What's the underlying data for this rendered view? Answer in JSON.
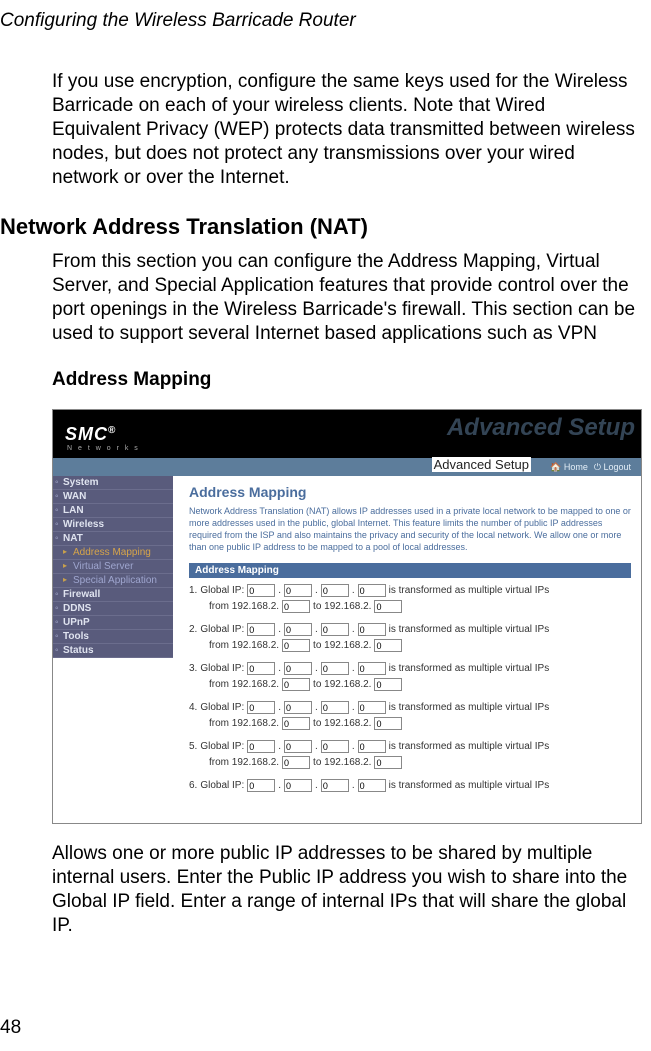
{
  "page": {
    "header_title": "Configuring the Wireless Barricade Router",
    "para1": "If you use encryption, configure the same keys used for the Wireless Barricade on each of your wireless clients. Note that Wired Equivalent Privacy (WEP) protects data transmitted between wireless nodes, but does not protect any transmissions over your wired network or over the Internet.",
    "h2": "Network Address Translation (NAT)",
    "para2": "From this section you can configure the Address Mapping, Virtual Server, and Special Application features that provide control over the port openings in the Wireless Barricade's firewall. This section can be used to support several Internet based applications such as VPN",
    "h3": "Address Mapping",
    "para3": "Allows one or more public IP addresses to be shared by multiple internal users. Enter the Public IP address you wish to share into the Global IP field. Enter a range of internal IPs that will share the global IP.",
    "page_number": "48"
  },
  "ui": {
    "logo_text": "SMC",
    "logo_reg": "®",
    "logo_sub": "N e t w o r k s",
    "adv_watermark": "Advanced Setup",
    "adv_label": "Advanced Setup",
    "home_link": "Home",
    "logout_link": "Logout",
    "sidebar": {
      "items": [
        "System",
        "WAN",
        "LAN",
        "Wireless",
        "NAT"
      ],
      "sub_items": [
        "Address Mapping",
        "Virtual Server",
        "Special Application"
      ],
      "items2": [
        "Firewall",
        "DDNS",
        "UPnP",
        "Tools",
        "Status"
      ]
    },
    "main": {
      "title": "Address Mapping",
      "desc": "Network Address Translation (NAT) allows IP addresses used in a private local network to be mapped to one or more addresses used in the public, global Internet. This feature limits the number of public IP addresses required from the ISP and also maintains the privacy and security of the local network. We allow one or more than one public IP address to be mapped to a pool of local addresses.",
      "section_bar": "Address Mapping",
      "row_global_prefix": "Global IP:",
      "row_transform": "is transformed as multiple virtual IPs",
      "row_from": "from 192.168.2.",
      "row_to": "to 192.168.2.",
      "rows": [
        {
          "n": "1",
          "a": "0",
          "b": "0",
          "c": "0",
          "d": "0",
          "f": "0",
          "t": "0"
        },
        {
          "n": "2",
          "a": "0",
          "b": "0",
          "c": "0",
          "d": "0",
          "f": "0",
          "t": "0"
        },
        {
          "n": "3",
          "a": "0",
          "b": "0",
          "c": "0",
          "d": "0",
          "f": "0",
          "t": "0"
        },
        {
          "n": "4",
          "a": "0",
          "b": "0",
          "c": "0",
          "d": "0",
          "f": "0",
          "t": "0"
        },
        {
          "n": "5",
          "a": "0",
          "b": "0",
          "c": "0",
          "d": "0",
          "f": "0",
          "t": "0"
        },
        {
          "n": "6",
          "a": "0",
          "b": "0",
          "c": "0",
          "d": "0",
          "f": "",
          "t": ""
        }
      ]
    }
  }
}
